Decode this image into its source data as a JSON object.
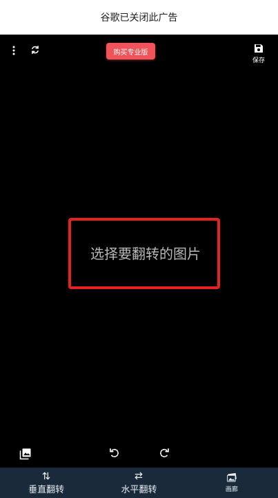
{
  "ad_banner": {
    "text": "谷歌已关闭此广告"
  },
  "toolbar": {
    "menu_icon": "more-vertical-icon",
    "refresh_icon": "refresh-icon",
    "buy_pro_label": "购买专业版",
    "save_label": "保存",
    "save_icon": "floppy-disk-icon"
  },
  "canvas": {
    "placeholder": "选择要翻转的图片"
  },
  "bottom_tools": {
    "gallery_icon": "image-icon",
    "rotate_left_icon": "rotate-ccw-icon",
    "rotate_right_icon": "rotate-cw-icon"
  },
  "nav": {
    "items": [
      {
        "label": "垂直翻转",
        "icon": "vertical-arrows-icon"
      },
      {
        "label": "水平翻转",
        "icon": "horizontal-arrows-icon"
      },
      {
        "label": "画廊",
        "icon": "gallery-icon"
      }
    ]
  },
  "colors": {
    "accent_red": "#f0545a",
    "border_red": "#e3221b",
    "nav_bg": "#1b2a3a"
  }
}
